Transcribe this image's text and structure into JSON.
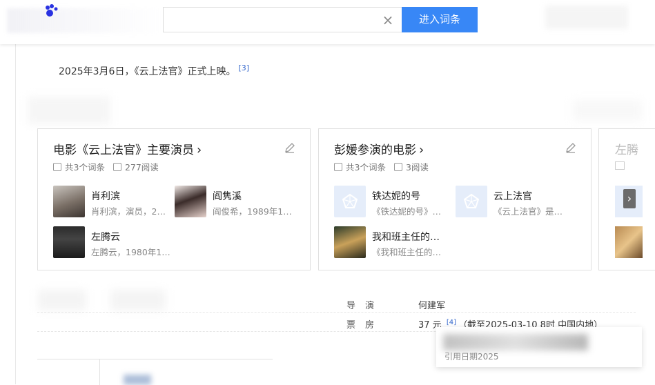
{
  "search": {
    "button_label": "进入词条",
    "clear_symbol": "×"
  },
  "release_text": "2025年3月6日，《云上法官》正式上映。",
  "release_ref": "[3]",
  "cards": [
    {
      "title": "电影《云上法官》主要演员",
      "chevron": "›",
      "count": "共3个词条",
      "reads": "277阅读",
      "items": [
        {
          "name": "肖利滨",
          "desc": "肖利滨，演员，2…"
        },
        {
          "name": "阎隽溪",
          "desc": "阎俊希，1989年1…"
        },
        {
          "name": "左腾云",
          "desc": "左腾云，1980年1…"
        }
      ]
    },
    {
      "title": "彭媛参演的电影",
      "chevron": "›",
      "count": "共3个词条",
      "reads": "3阅读",
      "items": [
        {
          "name": "铁达妮的号",
          "desc": "《铁达妮的号》…"
        },
        {
          "name": "云上法官",
          "desc": "《云上法官》是…"
        },
        {
          "name": "我和班主任的…",
          "desc": "《我和班主任的…"
        }
      ]
    }
  ],
  "card3": {
    "title": "左腾",
    "arrow": "›"
  },
  "info": [
    {
      "key": "导演",
      "value": "何建军"
    },
    {
      "key": "票房",
      "value": "37 元",
      "ref": "[4]",
      "note": "（截至2025-03-10 8时 中国内地）"
    }
  ],
  "popup": {
    "ref_text": "引用日期2025"
  }
}
